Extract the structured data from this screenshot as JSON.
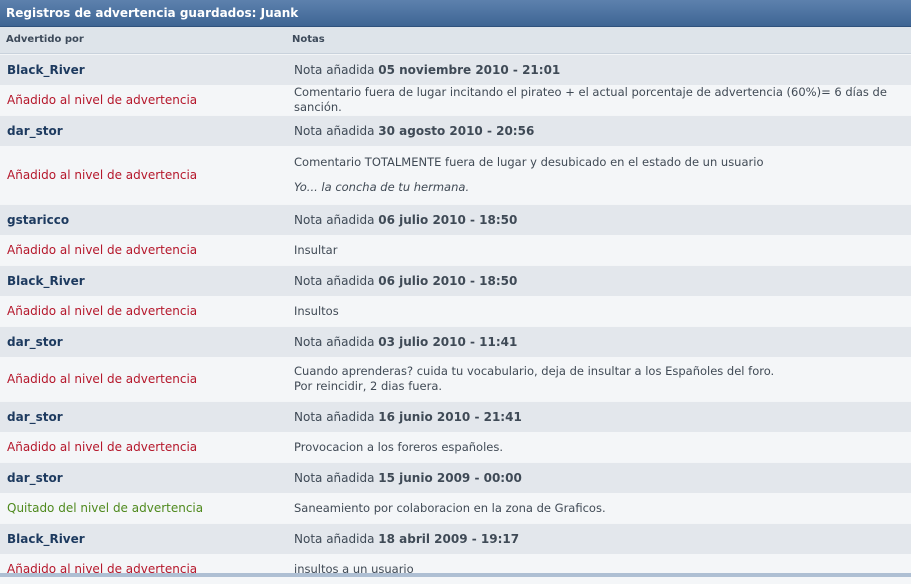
{
  "header": {
    "title": "Registros de advertencia guardados: Juank"
  },
  "columns": {
    "warned_by": "Advertido por",
    "notes": "Notas"
  },
  "nota_prefix": "Nota añadida",
  "entries": [
    {
      "user": "Black_River",
      "date": "05 noviembre 2010 - 21:01",
      "action": "Añadido al nivel de advertencia",
      "action_type": "added",
      "note": "Comentario fuera de lugar incitando el pirateo + el actual porcentaje de advertencia (60%)= 6 días de sanción.",
      "note2": "",
      "quote": ""
    },
    {
      "user": "dar_stor",
      "date": "30 agosto 2010 - 20:56",
      "action": "Añadido al nivel de advertencia",
      "action_type": "added",
      "note": "Comentario TOTALMENTE fuera de lugar y desubicado en el estado de un usuario",
      "note2": "",
      "quote": "Yo... la concha de tu hermana."
    },
    {
      "user": "gstaricco",
      "date": "06 julio 2010 - 18:50",
      "action": "Añadido al nivel de advertencia",
      "action_type": "added",
      "note": "Insultar",
      "note2": "",
      "quote": ""
    },
    {
      "user": "Black_River",
      "date": "06 julio 2010 - 18:50",
      "action": "Añadido al nivel de advertencia",
      "action_type": "added",
      "note": "Insultos",
      "note2": "",
      "quote": ""
    },
    {
      "user": "dar_stor",
      "date": "03 julio 2010 - 11:41",
      "action": "Añadido al nivel de advertencia",
      "action_type": "added",
      "note": "Cuando aprenderas? cuida tu vocabulario, deja de insultar a los Españoles del foro.",
      "note2": "Por reincidir, 2 dias fuera.",
      "quote": ""
    },
    {
      "user": "dar_stor",
      "date": "16 junio 2010 - 21:41",
      "action": "Añadido al nivel de advertencia",
      "action_type": "added",
      "note": "Provocacion a los foreros españoles.",
      "note2": "",
      "quote": ""
    },
    {
      "user": "dar_stor",
      "date": "15 junio 2009 - 00:00",
      "action": "Quitado del nivel de advertencia",
      "action_type": "removed",
      "note": "Saneamiento por colaboracion en la zona de Graficos.",
      "note2": "",
      "quote": ""
    },
    {
      "user": "Black_River",
      "date": "18 abril 2009 - 19:17",
      "action": "Añadido al nivel de advertencia",
      "action_type": "added",
      "note": "insultos a un usuario",
      "note2": "",
      "quote": ""
    }
  ],
  "colors": {
    "header_bg": "#3e6594",
    "added": "#b5172b",
    "removed": "#4f8a1e",
    "user_link": "#1d3a5f"
  }
}
